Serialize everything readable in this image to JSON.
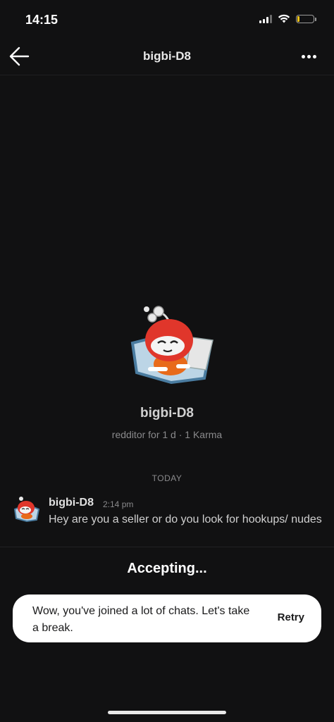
{
  "status_bar": {
    "time": "14:15",
    "battery_color": "#f5c518"
  },
  "header": {
    "title": "bigbi-D8",
    "back_icon": "arrow-left-icon",
    "more_icon": "more-horizontal-icon"
  },
  "profile": {
    "name": "bigbi-D8",
    "meta": "redditor for 1 d · 1 Karma",
    "avatar_icon": "snoo-avatar-icon"
  },
  "chat": {
    "date_label": "TODAY",
    "messages": [
      {
        "author": "bigbi-D8",
        "time": "2:14 pm",
        "text": "Hey are you a seller or do you look for hookups/ nudes"
      }
    ]
  },
  "status": {
    "accepting_label": "Accepting..."
  },
  "toast": {
    "text": "Wow, you've joined a lot of chats. Let's take a break.",
    "retry_label": "Retry"
  },
  "colors": {
    "background": "#111112",
    "snoo_red": "#e0362b",
    "toast_bg": "#ffffff"
  }
}
